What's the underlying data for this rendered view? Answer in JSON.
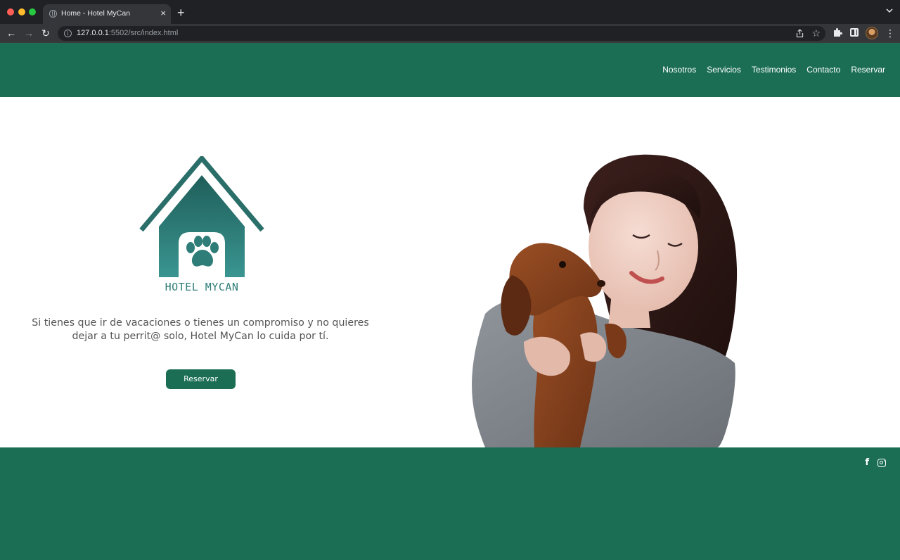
{
  "browser": {
    "tab_title": "Home - Hotel MyCan",
    "tab_close": "×",
    "new_tab": "+",
    "url_host": "127.0.0.1",
    "url_rest": ":5502/src/index.html"
  },
  "colors": {
    "brand_green": "#1b6e54",
    "logo_teal": "#2f7d78",
    "text_gray": "#555555"
  },
  "header": {
    "nav": [
      "Nosotros",
      "Servicios",
      "Testimonios",
      "Contacto",
      "Reservar"
    ]
  },
  "hero": {
    "logo_text": "HOTEL MYCAN",
    "tagline_line1": "Si tienes que ir de vacaciones o tienes un compromiso y no quieres",
    "tagline_line2": "dejar a tu perrit@ solo, Hotel MyCan lo cuida por tí.",
    "cta_label": "Reservar",
    "photo_icon": "woman-hugging-dog-photo"
  },
  "footer": {
    "social": [
      "facebook-icon",
      "instagram-icon"
    ],
    "facebook_glyph": "f"
  }
}
